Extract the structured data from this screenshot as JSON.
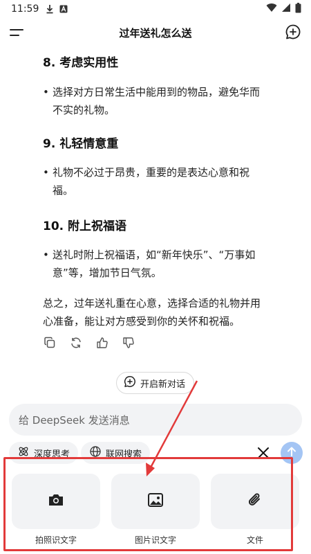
{
  "status_bar": {
    "time": "11:59"
  },
  "header": {
    "title": "过年送礼怎么送"
  },
  "content": {
    "sections": [
      {
        "title": "8. 考虑实用性",
        "bullet_lines": [
          "选择对方日常生活中能用到的物品，避免华而",
          "不实的礼物。"
        ]
      },
      {
        "title": "9. 礼轻情意重",
        "bullet_lines": [
          "礼物不必过于昂贵，重要的是表达心意和祝",
          "福。"
        ]
      },
      {
        "title": "10. 附上祝福语",
        "bullet_lines": [
          "送礼时附上祝福语，如“新年快乐”、“万事如",
          "意”等，增加节日气氛。"
        ]
      }
    ],
    "summary_lines": [
      "总之，过年送礼重在心意，选择合适的礼物并用",
      "心准备，能让对方感受到你的关怀和祝福。"
    ]
  },
  "new_dialog_label": "开启新对话",
  "input": {
    "placeholder": "给 DeepSeek 发送消息"
  },
  "chips": {
    "deep_think": "深度思考",
    "web_search": "联网搜索"
  },
  "attachments": [
    {
      "label": "拍照识文字",
      "icon": "camera-icon"
    },
    {
      "label": "图片识文字",
      "icon": "image-icon"
    },
    {
      "label": "文件",
      "icon": "paperclip-icon"
    }
  ],
  "colors": {
    "accent": "#4d6bfe",
    "send_disabled": "#a4c5f4",
    "annotation_red": "#e23a3a",
    "surface": "#f2f3f5"
  }
}
